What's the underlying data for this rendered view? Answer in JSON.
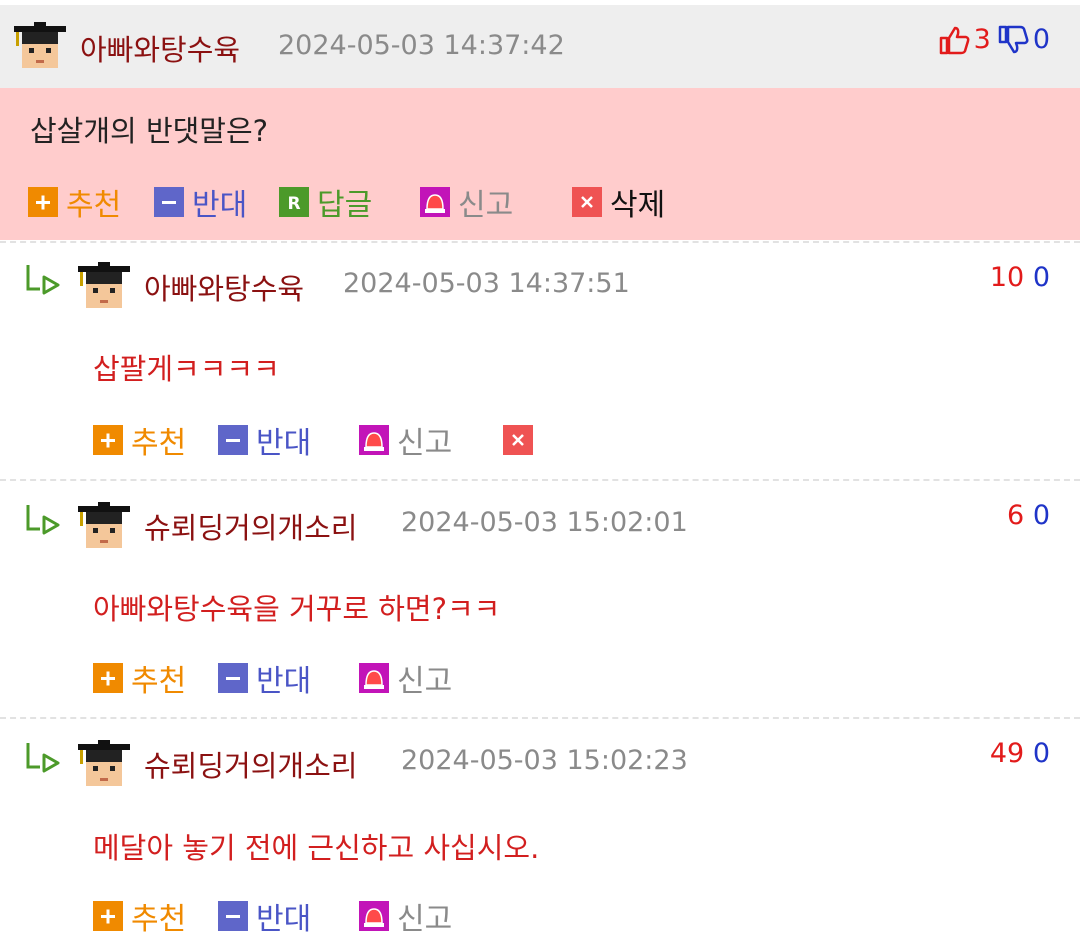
{
  "colors": {
    "header_bg": "#eeeeee",
    "highlight_bg": "#ffcccc",
    "username": "#8b1111",
    "comment_text": "#d21f1f",
    "recommend": "#f08a00",
    "oppose": "#4a55c6",
    "reply": "#4c9a2a",
    "report": "#8a8a8a",
    "upvote": "#e21b1b",
    "downvote": "#1f34c8"
  },
  "main_comment": {
    "username": "아빠와탕수육",
    "date": "2024-05-03 14:37:42",
    "upvotes": "3",
    "downvotes": "0",
    "text": "삽살개의 반댓말은?",
    "actions": {
      "recommend": "추천",
      "oppose": "반대",
      "reply": "답글",
      "report": "신고",
      "delete": "삭제"
    }
  },
  "replies": [
    {
      "username": "아빠와탕수육",
      "date": "2024-05-03 14:37:51",
      "upvotes": "10",
      "downvotes": "0",
      "text": "삽팔게ㅋㅋㅋㅋ",
      "actions": {
        "recommend": "추천",
        "oppose": "반대",
        "report": "신고"
      }
    },
    {
      "username": "슈뢰딩거의개소리",
      "date": "2024-05-03 15:02:01",
      "upvotes": "6",
      "downvotes": "0",
      "text": "아빠와탕수육을 거꾸로 하면?ㅋㅋ",
      "actions": {
        "recommend": "추천",
        "oppose": "반대",
        "report": "신고"
      }
    },
    {
      "username": "슈뢰딩거의개소리",
      "date": "2024-05-03 15:02:23",
      "upvotes": "49",
      "downvotes": "0",
      "text": "메달아 놓기 전에 근신하고 사십시오.",
      "actions": {
        "recommend": "추천",
        "oppose": "반대",
        "report": "신고"
      }
    }
  ]
}
